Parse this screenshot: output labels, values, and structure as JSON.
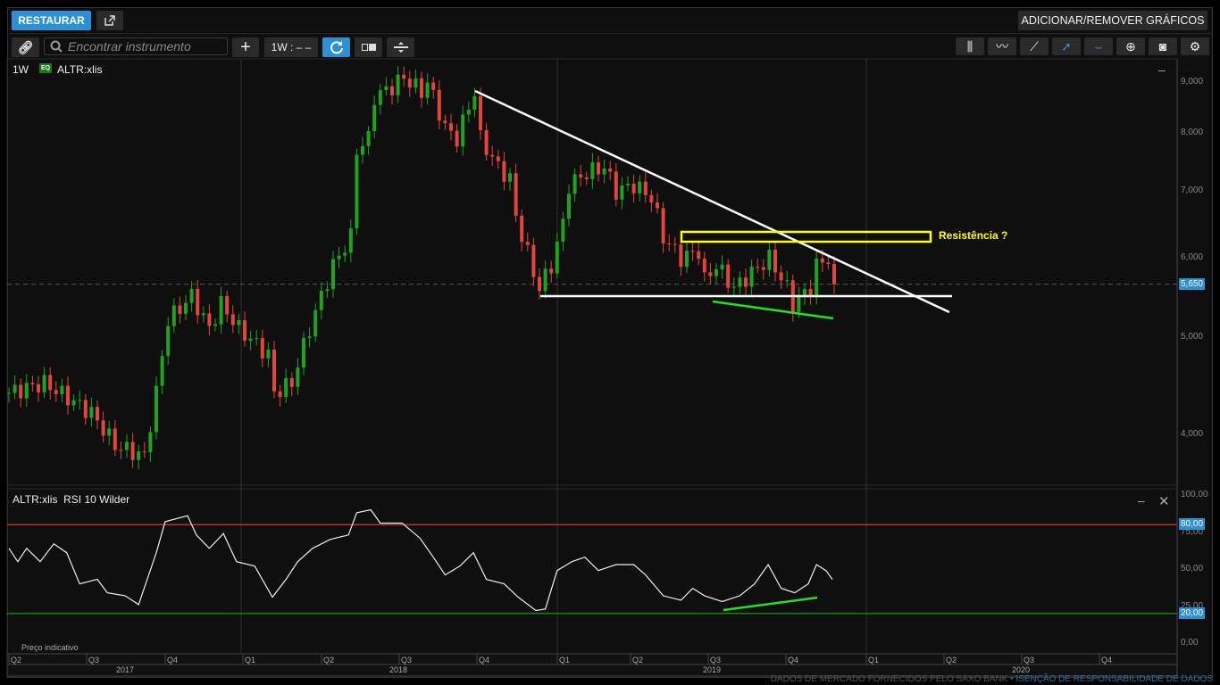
{
  "toolbar": {
    "restore_label": "RESTAURAR",
    "add_remove_label": "ADICIONAR/REMOVER GRÁFICOS",
    "search_placeholder": "Encontrar instrumento",
    "timeframe_label": "1W : – –",
    "icons": [
      "link-icon",
      "search-icon",
      "plus-icon",
      "refresh-icon",
      "layout-icon",
      "split-icon",
      "candles-icon",
      "indicators-icon",
      "line-tool-icon",
      "cursor-icon",
      "curve-icon",
      "zoom-icon",
      "camera-icon",
      "gear-icon"
    ]
  },
  "chart_header": {
    "interval": "1W",
    "type_badge": "EQ",
    "symbol": "ALTR:xlis"
  },
  "rsi_header": {
    "symbol": "ALTR:xlis",
    "indicator": "RSI 10 Wilder"
  },
  "annotation": "Resistência ?",
  "footer": {
    "source": "DADOS DE MERCADO FORNECIDOS PELO SAXO BANK",
    "separator": " • ",
    "disclaimer": "ISENÇÃO DE RESPONSABILIDADE DE DADOS",
    "indicative": "Preço indicativo"
  },
  "colors": {
    "accent": "#2d8fd5",
    "up": "#1fa31f",
    "down": "#e2463a",
    "rsi_upper": "#b8312a",
    "rsi_lower": "#1b7a1b",
    "annotation": "#ffff00",
    "divergence": "#22e022"
  },
  "chart_data": [
    {
      "type": "candlestick",
      "title": "ALTR:xlis 1W",
      "scale": "log",
      "ylim": [
        3.6,
        9.3
      ],
      "y_ticks": [
        {
          "v": 9,
          "label": "9,000"
        },
        {
          "v": 8,
          "label": "8,000"
        },
        {
          "v": 7,
          "label": "7,000"
        },
        {
          "v": 6,
          "label": "6,000"
        },
        {
          "v": 5,
          "label": "5,000"
        },
        {
          "v": 4,
          "label": "4,000"
        }
      ],
      "last_price": {
        "v": 5.65,
        "label": "5,650"
      },
      "closes_keypoints": [
        [
          0,
          4.4
        ],
        [
          6,
          4.5
        ],
        [
          14,
          4.2
        ],
        [
          18,
          3.9
        ],
        [
          23,
          3.8
        ],
        [
          25,
          4.4
        ],
        [
          27,
          5.2
        ],
        [
          31,
          5.5
        ],
        [
          34,
          5.1
        ],
        [
          36,
          5.4
        ],
        [
          39,
          5.1
        ],
        [
          44,
          4.8
        ],
        [
          45,
          4.4
        ],
        [
          48,
          4.5
        ],
        [
          50,
          4.9
        ],
        [
          53,
          5.5
        ],
        [
          55,
          5.9
        ],
        [
          58,
          6.3
        ],
        [
          59,
          7.7
        ],
        [
          61,
          7.9
        ],
        [
          62,
          8.7
        ],
        [
          65,
          8.9
        ],
        [
          67,
          9.1
        ],
        [
          70,
          8.8
        ],
        [
          71,
          9.0
        ],
        [
          74,
          8.1
        ],
        [
          76,
          7.9
        ],
        [
          79,
          8.8
        ],
        [
          80,
          7.9
        ],
        [
          83,
          7.4
        ],
        [
          85,
          7.2
        ],
        [
          86,
          6.6
        ],
        [
          89,
          5.8
        ],
        [
          90,
          5.6
        ],
        [
          92,
          5.9
        ],
        [
          94,
          6.5
        ],
        [
          95,
          7.1
        ],
        [
          98,
          7.3
        ],
        [
          101,
          7.4
        ],
        [
          103,
          7.0
        ],
        [
          106,
          7.1
        ],
        [
          109,
          6.9
        ],
        [
          111,
          6.3
        ],
        [
          114,
          6.0
        ],
        [
          117,
          6.1
        ],
        [
          118,
          5.7
        ],
        [
          120,
          5.9
        ],
        [
          123,
          5.6
        ],
        [
          126,
          5.8
        ],
        [
          129,
          6.0
        ],
        [
          132,
          5.6
        ],
        [
          133,
          5.4
        ],
        [
          136,
          5.6
        ],
        [
          137,
          5.9
        ],
        [
          139,
          6.0
        ],
        [
          140,
          5.85
        ]
      ]
    },
    {
      "type": "line",
      "title": "RSI 10 Wilder",
      "ylim": [
        0,
        100
      ],
      "y_ticks": [
        {
          "v": 100,
          "label": "100,00"
        },
        {
          "v": 75,
          "label": "75,00"
        },
        {
          "v": 50,
          "label": "50,00"
        },
        {
          "v": 25,
          "label": "25,00"
        },
        {
          "v": 0,
          "label": "0,00"
        }
      ],
      "levels": [
        {
          "v": 80,
          "label": "80,00"
        },
        {
          "v": 20,
          "label": "20,00"
        }
      ],
      "values_keypoints": [
        [
          0,
          64
        ],
        [
          1.5,
          55
        ],
        [
          3,
          64
        ],
        [
          5.3,
          55
        ],
        [
          7.6,
          67
        ],
        [
          9.8,
          61
        ],
        [
          12,
          40
        ],
        [
          15,
          43
        ],
        [
          16.7,
          34
        ],
        [
          19.7,
          32
        ],
        [
          22,
          26
        ],
        [
          25,
          61
        ],
        [
          26.5,
          82
        ],
        [
          30.3,
          86
        ],
        [
          31.8,
          73
        ],
        [
          34,
          64
        ],
        [
          36.4,
          74
        ],
        [
          38.6,
          55
        ],
        [
          41.7,
          52
        ],
        [
          44.7,
          31
        ],
        [
          47,
          43
        ],
        [
          49,
          55
        ],
        [
          51.5,
          64
        ],
        [
          54.5,
          70
        ],
        [
          57.6,
          73
        ],
        [
          59,
          88
        ],
        [
          61.4,
          90
        ],
        [
          63,
          81
        ],
        [
          66.7,
          81
        ],
        [
          69.7,
          71
        ],
        [
          72,
          58
        ],
        [
          74,
          46
        ],
        [
          76.5,
          52
        ],
        [
          78.8,
          61
        ],
        [
          81,
          43
        ],
        [
          84,
          40
        ],
        [
          86.4,
          31
        ],
        [
          89.4,
          22
        ],
        [
          91,
          23
        ],
        [
          93,
          49
        ],
        [
          95.5,
          55
        ],
        [
          97.7,
          58
        ],
        [
          100,
          49
        ],
        [
          103,
          53
        ],
        [
          106,
          53
        ],
        [
          108,
          46
        ],
        [
          111,
          32
        ],
        [
          114,
          29
        ],
        [
          116,
          37
        ],
        [
          118,
          32
        ],
        [
          121,
          28
        ],
        [
          124,
          32
        ],
        [
          126.5,
          40
        ],
        [
          128.8,
          53
        ],
        [
          131,
          37
        ],
        [
          133.3,
          34
        ],
        [
          135.6,
          40
        ],
        [
          137,
          53
        ],
        [
          138.6,
          49
        ],
        [
          139.7,
          43
        ]
      ]
    }
  ],
  "time_axis": {
    "quarters": [
      "Q2",
      "Q3",
      "Q4",
      "Q1",
      "Q2",
      "Q3",
      "Q4",
      "Q1",
      "Q2",
      "Q3",
      "Q4",
      "Q1",
      "Q2",
      "Q3",
      "Q4"
    ],
    "years": [
      "2017",
      "2018",
      "2019",
      "2020"
    ]
  }
}
